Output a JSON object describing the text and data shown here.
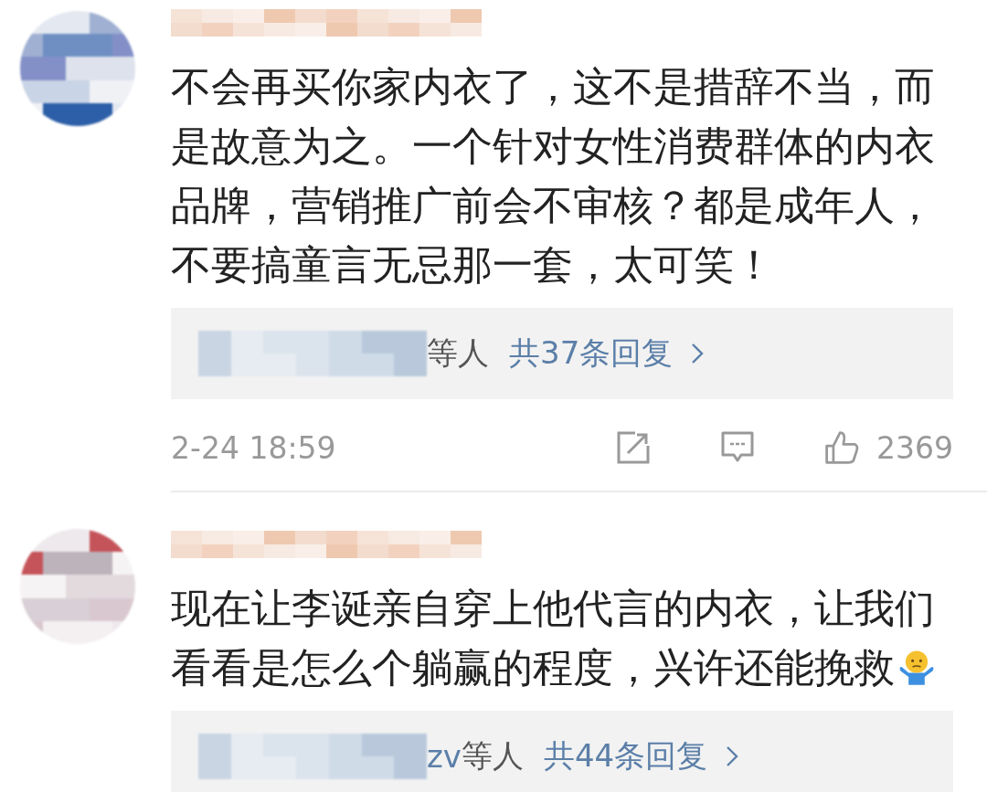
{
  "comments": [
    {
      "text": "不会再买你家内衣了，这不是措辞不当，而是故意为之。一个针对女性消费群体的内衣品牌，营销推广前会不审核？都是成年人，不要搞童言无忌那一套，太可笑！",
      "emoji": false,
      "replies": {
        "tail": "等人",
        "count": "共37条回复"
      },
      "time": "2-24 18:59",
      "likes": "2369"
    },
    {
      "text": "现在让李诞亲自穿上他代言的内衣，让我们看看是怎么个躺赢的程度，兴许还能挽救",
      "emoji": true,
      "replies": {
        "names_tail": "zv",
        "tail": "等人",
        "count": "共44条回复"
      }
    }
  ]
}
